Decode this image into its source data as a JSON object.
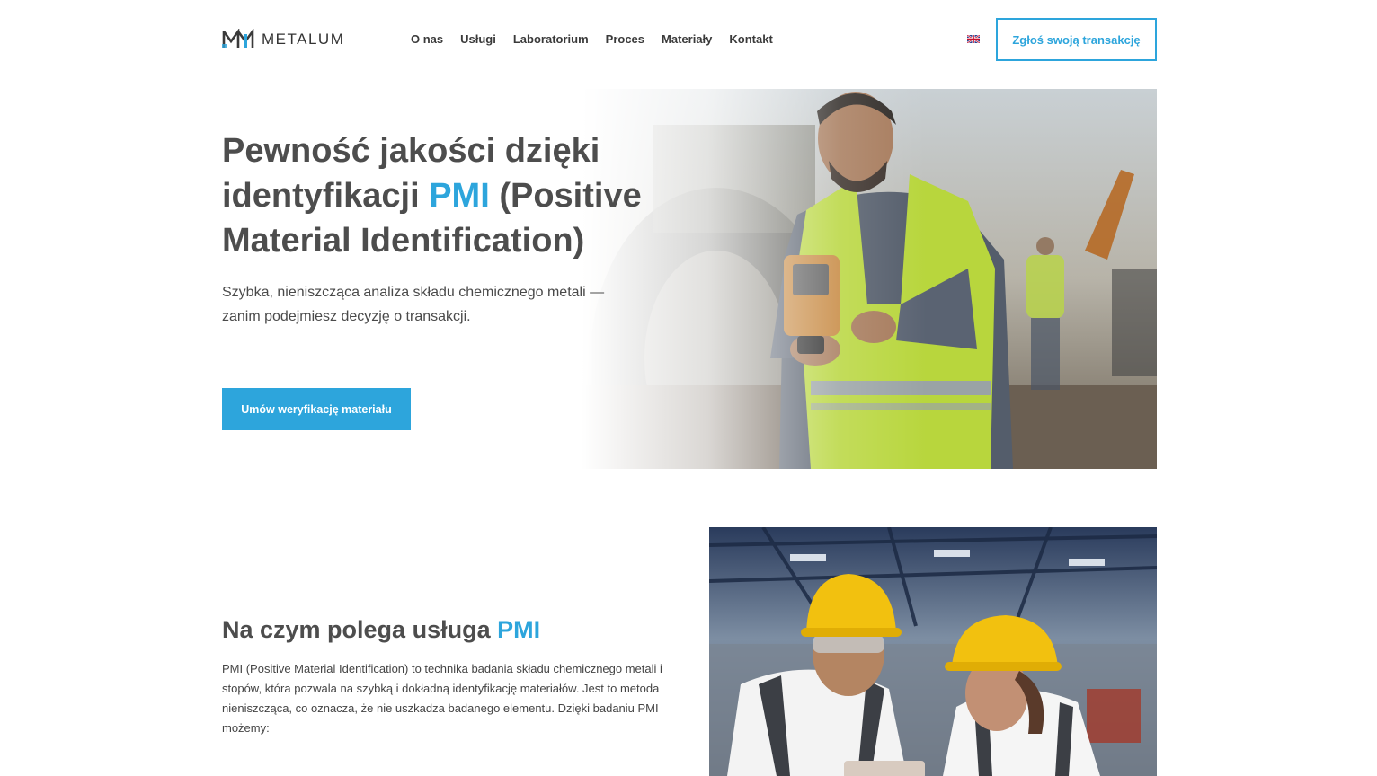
{
  "brand": {
    "name": "METALUM",
    "accent_color": "#2da5dc"
  },
  "nav": {
    "items": [
      {
        "label": "O nas"
      },
      {
        "label": "Usługi"
      },
      {
        "label": "Laboratorium"
      },
      {
        "label": "Proces"
      },
      {
        "label": "Materiały"
      },
      {
        "label": "Kontakt"
      }
    ],
    "language_icon": "uk-flag-icon",
    "cta_label": "Zgłoś swoją transakcję"
  },
  "hero": {
    "title_part1": "Pewność jakości dzięki identyfikacji ",
    "title_accent": "PMI",
    "title_part2": " (Positive Material Identification)",
    "subtitle": "Szybka, nieniszcząca analiza składu chemicznego metali — zanim podejmiesz decyzję o transakcji.",
    "cta_label": "Umów weryfikację materiału",
    "image": "worker-with-xrf-analyzer-photo"
  },
  "service": {
    "title_part1": "Na czym polega usługa ",
    "title_accent": "PMI",
    "body": "PMI (Positive Material Identification) to technika badania składu chemicznego metali i stopów, która pozwala na szybką i dokładną identyfikację materiałów. Jest to metoda nieniszcząca, co oznacza, że nie uszkadza badanego elementu. Dzięki badaniu PMI możemy:",
    "image": "workers-in-hard-hats-photo"
  }
}
